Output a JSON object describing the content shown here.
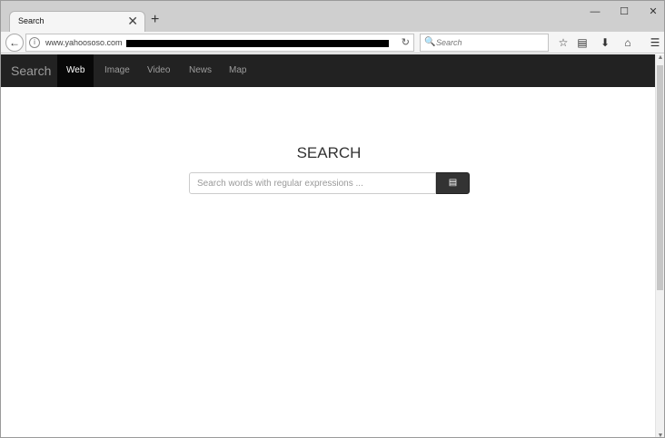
{
  "browser": {
    "tab_title": "Search",
    "tab_close": "✕",
    "new_tab": "+",
    "url": "www.yahoososo.com",
    "search_placeholder": "Search",
    "window_controls": {
      "minimize": "—",
      "maximize": "☐",
      "close": "✕"
    }
  },
  "site": {
    "brand": "Search",
    "nav": [
      {
        "label": "Web",
        "active": true
      },
      {
        "label": "Image",
        "active": false
      },
      {
        "label": "Video",
        "active": false
      },
      {
        "label": "News",
        "active": false
      },
      {
        "label": "Map",
        "active": false
      }
    ],
    "heading": "SEARCH",
    "search_placeholder": "Search words with regular expressions ...",
    "search_button_icon": "clipboard-icon"
  },
  "colors": {
    "navbar": "#222222",
    "active_tab": "#080808",
    "button": "#333333"
  }
}
